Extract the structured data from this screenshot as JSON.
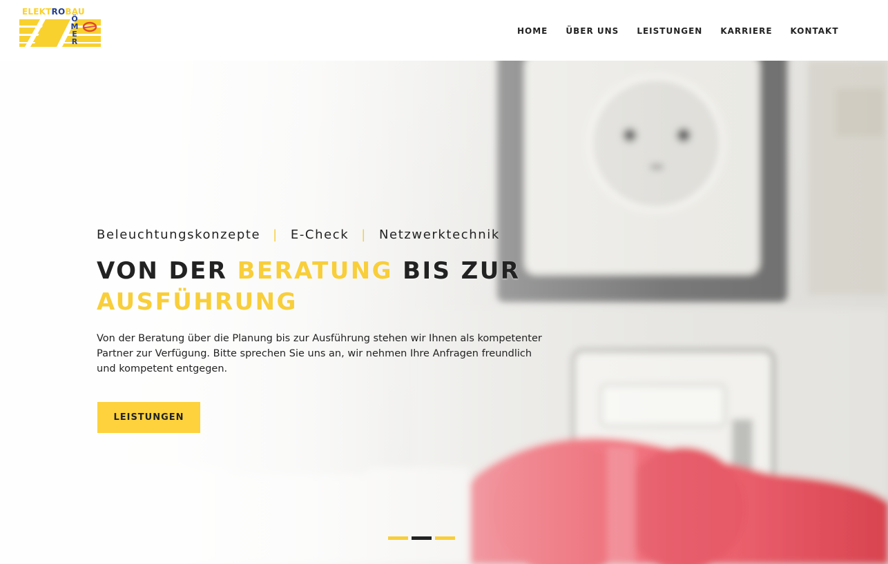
{
  "brand": {
    "logo_top_yellow": "ELEKT",
    "logo_top_blue": "RO",
    "logo_top_yellow2": "BAU",
    "logo_vertical": [
      "Ö",
      "M",
      "E",
      "R"
    ],
    "color_yellow": "#f8d12f",
    "color_blue": "#243f8f"
  },
  "nav": {
    "items": [
      {
        "label": "HOME"
      },
      {
        "label": "ÜBER UNS"
      },
      {
        "label": "LEISTUNGEN"
      },
      {
        "label": "KARRIERE"
      },
      {
        "label": "KONTAKT"
      }
    ]
  },
  "hero": {
    "tags": [
      "Beleuchtungskonzepte",
      "E-Check",
      "Netzwerktechnik"
    ],
    "tag_separator": "|",
    "headline": {
      "part1": "VON DER ",
      "highlight1": "BERATUNG",
      "part2": " BIS ZUR ",
      "highlight2": "AUSFÜHRUNG"
    },
    "description": "Von der Beratung über die Planung bis zur Ausführung stehen wir Ihnen als kompetenter Partner zur Verfügung. Bitte sprechen Sie uns an, wir nehmen Ihre Anfragen freundlich und kompetent entgegen.",
    "cta_label": "LEISTUNGEN",
    "accent_color": "#f8ce3a",
    "slider": {
      "slides": 3,
      "active_index": 1
    }
  }
}
